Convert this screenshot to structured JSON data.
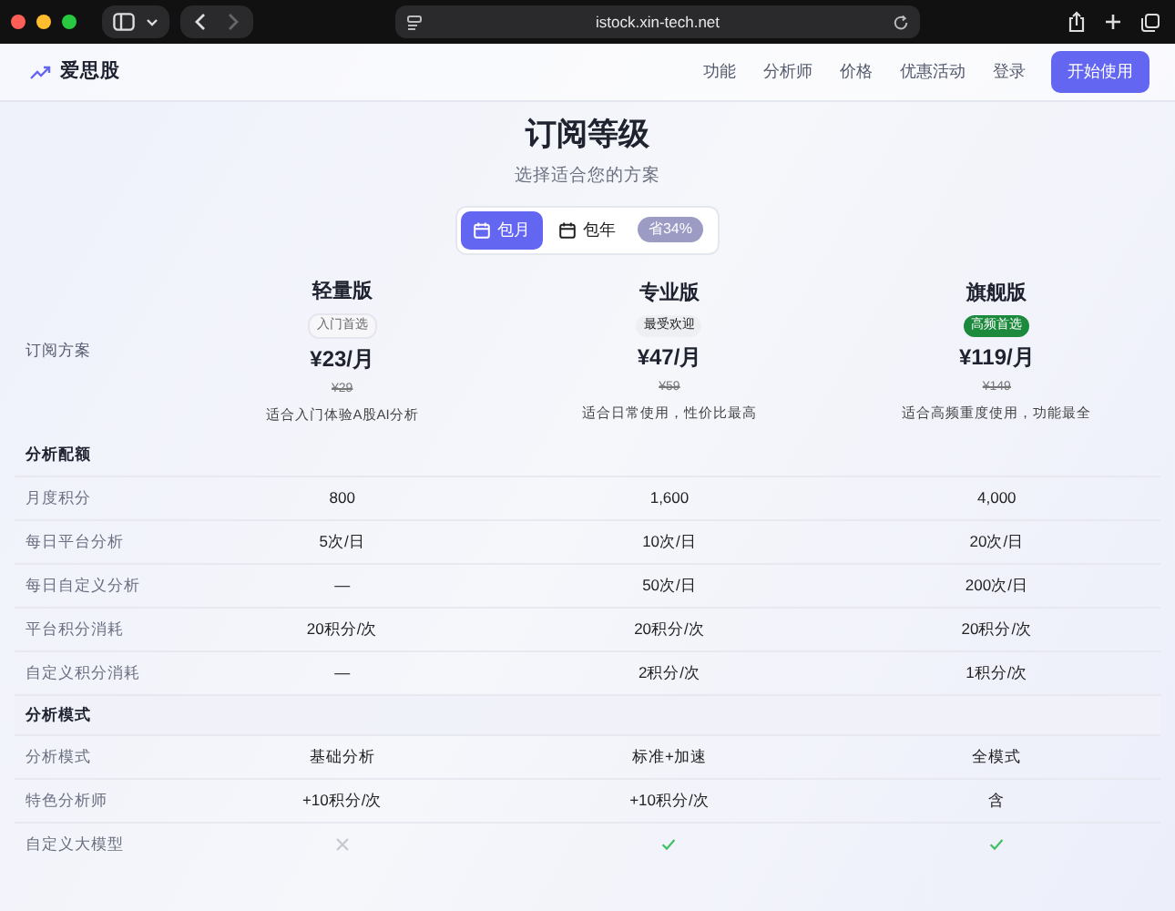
{
  "browser": {
    "url": "istock.xin-tech.net",
    "back_disabled": false,
    "forward_disabled": true
  },
  "navbar": {
    "brand": "爱思股",
    "links": [
      "功能",
      "分析师",
      "价格",
      "优惠活动",
      "登录"
    ],
    "cta": "开始使用"
  },
  "header": {
    "title": "订阅等级",
    "subtitle": "选择适合您的方案"
  },
  "billing_toggle": {
    "options": [
      {
        "label": "包月",
        "selected": true
      },
      {
        "label": "包年",
        "selected": false
      }
    ],
    "discount": "省34%"
  },
  "plans_label": "订阅方案",
  "plans": [
    {
      "name": "轻量版",
      "badge": {
        "text": "入门首选",
        "kind": "outline"
      },
      "price": "¥23/月",
      "old_price": "¥29",
      "description": "适合入门体验A股AI分析"
    },
    {
      "name": "专业版",
      "badge": {
        "text": "最受欢迎",
        "kind": "light"
      },
      "price": "¥47/月",
      "old_price": "¥59",
      "description": "适合日常使用，性价比最高"
    },
    {
      "name": "旗舰版",
      "badge": {
        "text": "高频首选",
        "kind": "success"
      },
      "price": "¥119/月",
      "old_price": "¥149",
      "description": "适合高频重度使用，功能最全"
    }
  ],
  "sections": [
    {
      "title": "分析配额",
      "rows": [
        {
          "label": "月度积分",
          "cells": [
            {
              "kind": "text",
              "text": "800"
            },
            {
              "kind": "text",
              "text": "1,600"
            },
            {
              "kind": "text",
              "text": "4,000"
            }
          ]
        },
        {
          "label": "每日平台分析",
          "cells": [
            {
              "kind": "text",
              "text": "5次/日"
            },
            {
              "kind": "text",
              "text": "10次/日"
            },
            {
              "kind": "text",
              "text": "20次/日"
            }
          ]
        },
        {
          "label": "每日自定义分析",
          "cells": [
            {
              "kind": "text",
              "text": "—"
            },
            {
              "kind": "text",
              "text": "50次/日"
            },
            {
              "kind": "text",
              "text": "200次/日"
            }
          ]
        },
        {
          "label": "平台积分消耗",
          "cells": [
            {
              "kind": "text",
              "text": "20积分/次"
            },
            {
              "kind": "text",
              "text": "20积分/次"
            },
            {
              "kind": "text",
              "text": "20积分/次"
            }
          ]
        },
        {
          "label": "自定义积分消耗",
          "cells": [
            {
              "kind": "text",
              "text": "—"
            },
            {
              "kind": "text",
              "text": "2积分/次"
            },
            {
              "kind": "text",
              "text": "1积分/次"
            }
          ]
        }
      ]
    },
    {
      "title": "分析模式",
      "rows": [
        {
          "label": "分析模式",
          "cells": [
            {
              "kind": "text",
              "text": "基础分析"
            },
            {
              "kind": "text",
              "text": "标准+加速"
            },
            {
              "kind": "text",
              "text": "全模式"
            }
          ]
        },
        {
          "label": "特色分析师",
          "cells": [
            {
              "kind": "text",
              "text": "+10积分/次"
            },
            {
              "kind": "text",
              "text": "+10积分/次"
            },
            {
              "kind": "text",
              "text": "含"
            }
          ]
        },
        {
          "label": "自定义大模型",
          "cells": [
            {
              "kind": "included",
              "included": false
            },
            {
              "kind": "included",
              "included": true
            },
            {
              "kind": "included",
              "included": true
            }
          ]
        }
      ]
    }
  ]
}
